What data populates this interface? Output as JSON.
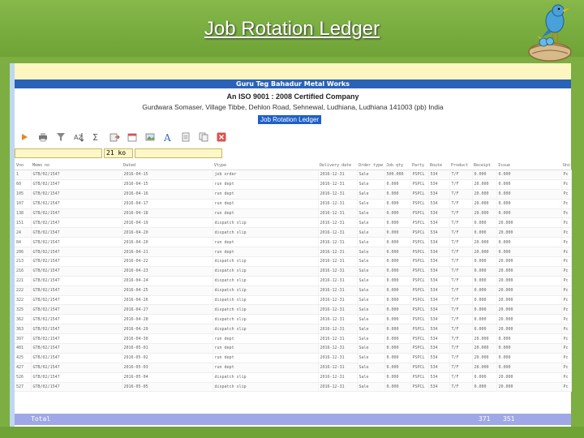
{
  "slide": {
    "title": "Job Rotation Ledger"
  },
  "report": {
    "company": "Guru Teg Bahadur Metal Works",
    "iso": "An ISO 9001 : 2008 Certified Company",
    "address": "Gurdwara Somaser, Village Tibbe, Dehlon Road, Sehnewal, Ludhiana, Ludhiana 141003 (pb) India",
    "ledger_label": "Job Rotation Ledger"
  },
  "toolbar": {
    "icons": [
      "refresh-icon",
      "print-icon",
      "filter-icon",
      "sort-icon",
      "sum-icon",
      "export-icon",
      "calendar-icon",
      "image-icon",
      "text-icon",
      "document-icon",
      "copy-icon",
      "close-icon"
    ]
  },
  "filters": {
    "select_value": "21 ko"
  },
  "table": {
    "columns": [
      "Vno",
      "Memo no",
      "Dated",
      "Vtype",
      "Delivery date",
      "Order type",
      "Job qty",
      "Party",
      "Route",
      "Product",
      "Receipt",
      "Issue",
      "Unit"
    ],
    "rows": [
      [
        "1",
        "GTB/02/1547",
        "2016-04-15",
        "job order",
        "2016-12-31",
        "Sale",
        "500.000",
        "PSPCL",
        "534",
        "T/F",
        "0.000",
        "0.000",
        "Pc"
      ],
      [
        "60",
        "GTB/02/1547",
        "2016-04-15",
        "run dept",
        "2016-12-31",
        "Sale",
        "0.000",
        "PSPCL",
        "534",
        "T/F",
        "20.000",
        "0.000",
        "Pc"
      ],
      [
        "105",
        "GTB/02/1547",
        "2016-04-16",
        "run dept",
        "2016-12-31",
        "Sale",
        "0.000",
        "PSPCL",
        "534",
        "T/F",
        "20.000",
        "0.000",
        "Pc"
      ],
      [
        "107",
        "GTB/02/1547",
        "2016-04-17",
        "run dept",
        "2016-12-31",
        "Sale",
        "0.000",
        "PSPCL",
        "534",
        "T/F",
        "20.000",
        "0.000",
        "Pc"
      ],
      [
        "138",
        "GTB/02/1547",
        "2016-04-18",
        "run dept",
        "2016-12-31",
        "Sale",
        "0.000",
        "PSPCL",
        "534",
        "T/F",
        "20.000",
        "0.000",
        "Pc"
      ],
      [
        "151",
        "GTB/02/1547",
        "2016-04-19",
        "dispatch slip",
        "2016-12-31",
        "Sale",
        "0.000",
        "PSPCL",
        "534",
        "T/F",
        "0.000",
        "20.000",
        "Pc"
      ],
      [
        "24",
        "GTB/02/1547",
        "2016-04-20",
        "dispatch slip",
        "2016-12-31",
        "Sale",
        "0.000",
        "PSPCL",
        "534",
        "T/F",
        "0.000",
        "20.000",
        "Pc"
      ],
      [
        "84",
        "GTB/02/1547",
        "2016-04-20",
        "run dept",
        "2016-12-31",
        "Sale",
        "0.000",
        "PSPCL",
        "534",
        "T/F",
        "20.000",
        "0.000",
        "Pc"
      ],
      [
        "206",
        "GTB/02/1547",
        "2016-04-21",
        "run dept",
        "2016-12-31",
        "Sale",
        "0.000",
        "PSPCL",
        "534",
        "T/F",
        "20.000",
        "0.000",
        "Pc"
      ],
      [
        "213",
        "GTB/02/1547",
        "2016-04-22",
        "dispatch slip",
        "2016-12-31",
        "Sale",
        "0.000",
        "PSPCL",
        "534",
        "T/F",
        "0.000",
        "20.000",
        "Pc"
      ],
      [
        "216",
        "GTB/02/1547",
        "2016-04-23",
        "dispatch slip",
        "2016-12-31",
        "Sale",
        "0.000",
        "PSPCL",
        "534",
        "T/F",
        "0.000",
        "20.000",
        "Pc"
      ],
      [
        "221",
        "GTB/02/1547",
        "2016-04-24",
        "dispatch slip",
        "2016-12-31",
        "Sale",
        "0.000",
        "PSPCL",
        "534",
        "T/F",
        "0.000",
        "20.000",
        "Pc"
      ],
      [
        "222",
        "GTB/02/1547",
        "2016-04-25",
        "dispatch slip",
        "2016-12-31",
        "Sale",
        "0.000",
        "PSPCL",
        "534",
        "T/F",
        "0.000",
        "20.000",
        "Pc"
      ],
      [
        "322",
        "GTB/02/1547",
        "2016-04-26",
        "dispatch slip",
        "2016-12-31",
        "Sale",
        "0.000",
        "PSPCL",
        "534",
        "T/F",
        "0.000",
        "20.000",
        "Pc"
      ],
      [
        "325",
        "GTB/02/1547",
        "2016-04-27",
        "dispatch slip",
        "2016-12-31",
        "Sale",
        "0.000",
        "PSPCL",
        "534",
        "T/F",
        "0.000",
        "20.000",
        "Pc"
      ],
      [
        "362",
        "GTB/02/1547",
        "2016-04-28",
        "dispatch slip",
        "2016-12-31",
        "Sale",
        "0.000",
        "PSPCL",
        "534",
        "T/F",
        "0.000",
        "20.000",
        "Pc"
      ],
      [
        "363",
        "GTB/02/1547",
        "2016-04-29",
        "dispatch slip",
        "2016-12-31",
        "Sale",
        "0.000",
        "PSPCL",
        "534",
        "T/F",
        "0.000",
        "20.000",
        "Pc"
      ],
      [
        "397",
        "GTB/02/1547",
        "2016-04-30",
        "run dept",
        "2016-12-31",
        "Sale",
        "0.000",
        "PSPCL",
        "534",
        "T/F",
        "20.000",
        "0.000",
        "Pc"
      ],
      [
        "401",
        "GTB/02/1547",
        "2016-05-01",
        "run dept",
        "2016-12-31",
        "Sale",
        "0.000",
        "PSPCL",
        "534",
        "T/F",
        "20.000",
        "0.000",
        "Pc"
      ],
      [
        "425",
        "GTB/02/1547",
        "2016-05-02",
        "run dept",
        "2016-12-31",
        "Sale",
        "0.000",
        "PSPCL",
        "534",
        "T/F",
        "20.000",
        "0.000",
        "Pc"
      ],
      [
        "427",
        "GTB/02/1547",
        "2016-05-03",
        "run dept",
        "2016-12-31",
        "Sale",
        "0.000",
        "PSPCL",
        "534",
        "T/F",
        "20.000",
        "0.000",
        "Pc"
      ],
      [
        "526",
        "GTB/02/1547",
        "2016-05-04",
        "dispatch slip",
        "2016-12-31",
        "Sale",
        "0.000",
        "PSPCL",
        "534",
        "T/F",
        "0.000",
        "20.000",
        "Pc"
      ],
      [
        "527",
        "GTB/02/1547",
        "2016-05-05",
        "dispatch slip",
        "2016-12-31",
        "Sale",
        "0.000",
        "PSPCL",
        "534",
        "T/F",
        "0.000",
        "20.000",
        "Pc"
      ]
    ]
  },
  "totals": {
    "label": "Total",
    "receipt": "371",
    "issue": "351"
  }
}
